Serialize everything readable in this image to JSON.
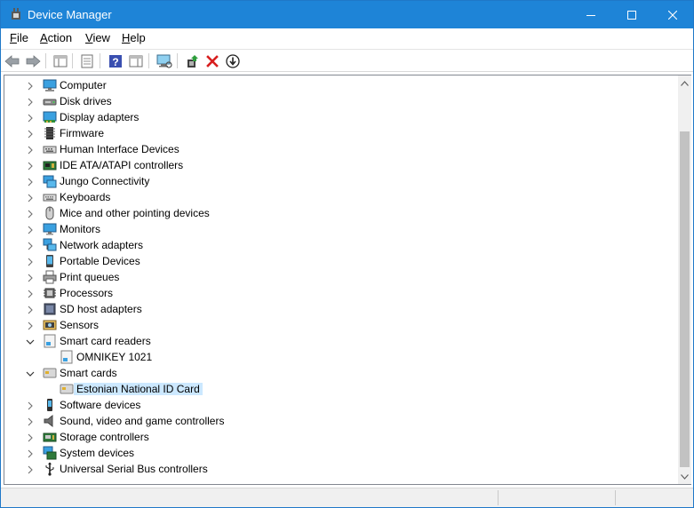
{
  "window": {
    "title": "Device Manager"
  },
  "menu": [
    {
      "key": "F",
      "rest": "ile"
    },
    {
      "key": "A",
      "rest": "ction"
    },
    {
      "key": "V",
      "rest": "iew"
    },
    {
      "key": "H",
      "rest": "elp"
    }
  ],
  "tree": [
    {
      "label": "Computer",
      "icon": "computer-icon",
      "expanded": false,
      "level": 0
    },
    {
      "label": "Disk drives",
      "icon": "disk-drive-icon",
      "expanded": false,
      "level": 0
    },
    {
      "label": "Display adapters",
      "icon": "display-adapter-icon",
      "expanded": false,
      "level": 0
    },
    {
      "label": "Firmware",
      "icon": "firmware-icon",
      "expanded": false,
      "level": 0
    },
    {
      "label": "Human Interface Devices",
      "icon": "hid-icon",
      "expanded": false,
      "level": 0
    },
    {
      "label": "IDE ATA/ATAPI controllers",
      "icon": "ide-controller-icon",
      "expanded": false,
      "level": 0
    },
    {
      "label": "Jungo Connectivity",
      "icon": "jungo-icon",
      "expanded": false,
      "level": 0
    },
    {
      "label": "Keyboards",
      "icon": "keyboard-icon",
      "expanded": false,
      "level": 0
    },
    {
      "label": "Mice and other pointing devices",
      "icon": "mouse-icon",
      "expanded": false,
      "level": 0
    },
    {
      "label": "Monitors",
      "icon": "monitor-icon",
      "expanded": false,
      "level": 0
    },
    {
      "label": "Network adapters",
      "icon": "network-adapter-icon",
      "expanded": false,
      "level": 0
    },
    {
      "label": "Portable Devices",
      "icon": "portable-device-icon",
      "expanded": false,
      "level": 0
    },
    {
      "label": "Print queues",
      "icon": "printer-icon",
      "expanded": false,
      "level": 0
    },
    {
      "label": "Processors",
      "icon": "processor-icon",
      "expanded": false,
      "level": 0
    },
    {
      "label": "SD host adapters",
      "icon": "sd-host-icon",
      "expanded": false,
      "level": 0
    },
    {
      "label": "Sensors",
      "icon": "sensor-icon",
      "expanded": false,
      "level": 0
    },
    {
      "label": "Smart card readers",
      "icon": "smart-card-reader-icon",
      "expanded": true,
      "level": 0
    },
    {
      "label": "OMNIKEY 1021",
      "icon": "smart-card-reader-icon",
      "level": 1
    },
    {
      "label": "Smart cards",
      "icon": "smart-card-icon",
      "expanded": true,
      "level": 0
    },
    {
      "label": "Estonian National ID Card",
      "icon": "smart-card-icon",
      "level": 1,
      "selected": true
    },
    {
      "label": "Software devices",
      "icon": "software-device-icon",
      "expanded": false,
      "level": 0
    },
    {
      "label": "Sound, video and game controllers",
      "icon": "speaker-icon",
      "expanded": false,
      "level": 0
    },
    {
      "label": "Storage controllers",
      "icon": "storage-controller-icon",
      "expanded": false,
      "level": 0
    },
    {
      "label": "System devices",
      "icon": "system-device-icon",
      "expanded": false,
      "level": 0
    },
    {
      "label": "Universal Serial Bus controllers",
      "icon": "usb-icon",
      "expanded": false,
      "level": 0
    }
  ],
  "colors": {
    "titlebar": "#1e84d7",
    "selection": "#cce8ff"
  }
}
